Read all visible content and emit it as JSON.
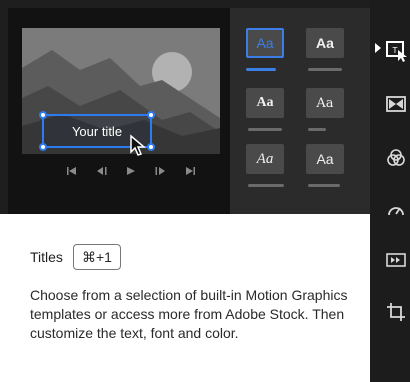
{
  "preview": {
    "title_text": "Your title"
  },
  "templates": {
    "tiles": [
      {
        "label": "Aa"
      },
      {
        "label": "Aa"
      },
      {
        "label": "Aa"
      },
      {
        "label": "Aa"
      },
      {
        "label": "Aa"
      },
      {
        "label": "Aa"
      }
    ]
  },
  "tooltip": {
    "title": "Titles",
    "shortcut": "⌘+1",
    "description": "Choose from a selection of built-in Motion Graphics templates or access more from Adobe Stock. Then customize the text, font and color."
  },
  "colors": {
    "accent": "#2d7bf2",
    "dark_bg": "#1e1e1e",
    "tile_bg": "#4a4a4a"
  }
}
